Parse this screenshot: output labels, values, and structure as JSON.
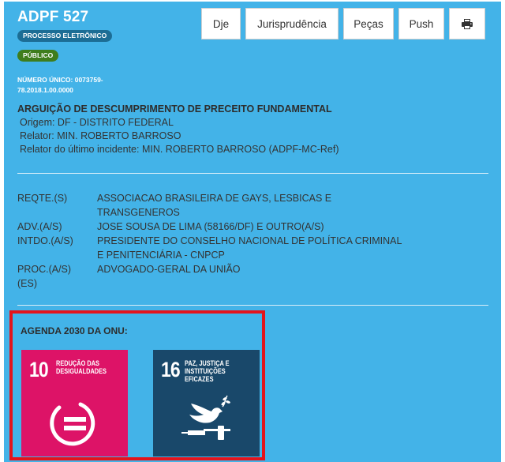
{
  "header": {
    "case_title": "ADPF 527",
    "badge_electronic": "PROCESSO ELETRÔNICO",
    "badge_public": "PÚBLICO",
    "unique_number": "NÚMERO ÚNICO: 0073759-78.2018.1.00.0000"
  },
  "toolbar": {
    "dje": "Dje",
    "jurisprudencia": "Jurisprudência",
    "pecas": "Peças",
    "push": "Push",
    "print_icon": "printer-icon"
  },
  "case_class": {
    "title": "ARGUIÇÃO DE DESCUMPRIMENTO DE PRECEITO FUNDAMENTAL",
    "origem": "Origem: DF - DISTRITO FEDERAL",
    "relator": "Relator: MIN. ROBERTO BARROSO",
    "relator_ultimo": "Relator do último incidente: MIN. ROBERTO BARROSO (ADPF-MC-Ref)"
  },
  "parties": [
    {
      "role": "REQTE.(S)",
      "name": "ASSOCIACAO BRASILEIRA DE GAYS, LESBICAS E TRANSGENEROS"
    },
    {
      "role": "ADV.(A/S)",
      "name": "JOSE SOUSA DE LIMA (58166/DF) E OUTRO(A/S)"
    },
    {
      "role": "INTDO.(A/S)",
      "name": "PRESIDENTE DO CONSELHO NACIONAL DE POLÍTICA CRIMINAL E PENITENCIÁRIA - CNPCP"
    },
    {
      "role": "PROC.(A/S)(ES)",
      "name": "ADVOGADO-GERAL DA UNIÃO"
    }
  ],
  "agenda": {
    "title": "AGENDA 2030 DA ONU:",
    "goals": [
      {
        "number": "10",
        "label": "REDUÇÃO DAS DESIGUALDADES",
        "color": "#dd1367",
        "icon": "equality-icon"
      },
      {
        "number": "16",
        "label": "PAZ, JUSTIÇA E INSTITUIÇÕES EFICAZES",
        "color": "#19486a",
        "icon": "dove-gavel-icon"
      }
    ]
  },
  "colors": {
    "panel": "#43b3e8",
    "highlight_border": "#e3141c",
    "badge_electronic": "#1c6d95",
    "badge_public": "#3f7d1c"
  }
}
